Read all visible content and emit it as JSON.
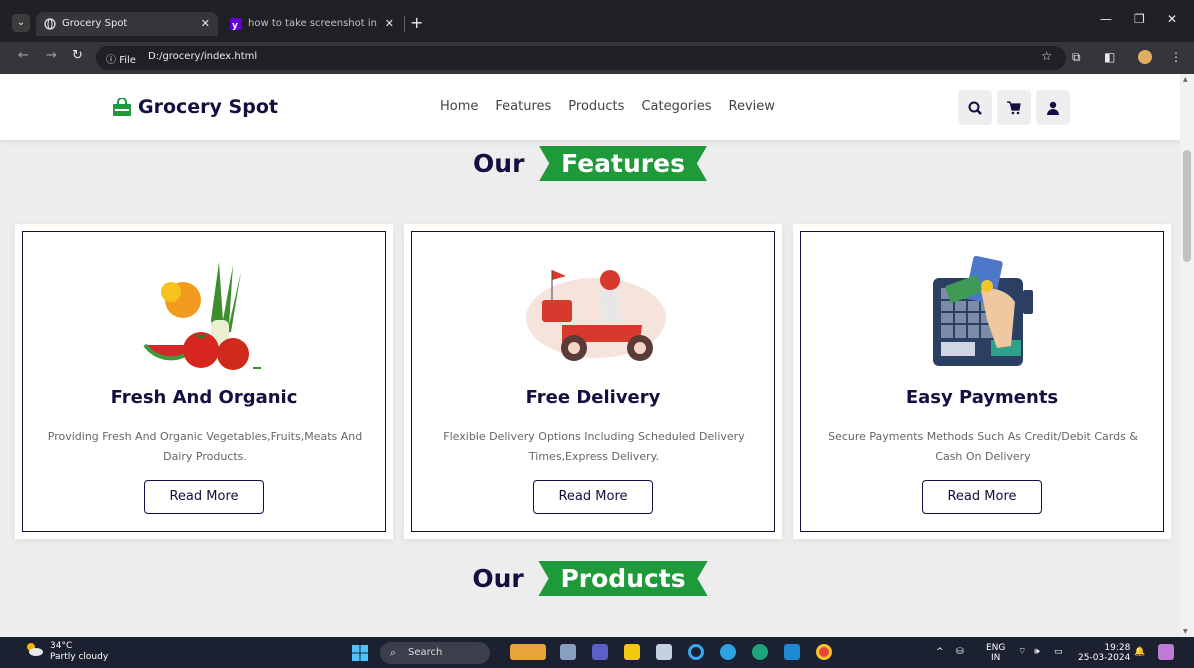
{
  "browser": {
    "tabs": [
      {
        "title": "Grocery Spot",
        "active": true
      },
      {
        "title": "how to take screenshot in lapto",
        "active": false
      }
    ],
    "omnibox": {
      "scheme_label": "File",
      "url": "D:/grocery/index.html"
    }
  },
  "site": {
    "logo": "Grocery Spot",
    "nav": [
      "Home",
      "Features",
      "Products",
      "Categories",
      "Review"
    ],
    "features_heading": {
      "prefix": "Our",
      "highlight": "Features"
    },
    "cards": [
      {
        "title": "Fresh And Organic",
        "description": "Providing Fresh And Organic Vegetables,Fruits,Meats And Dairy Products.",
        "button": "Read More",
        "image": "vegetables-illustration"
      },
      {
        "title": "Free Delivery",
        "description": "Flexible Delivery Options Including Scheduled Delivery Times,Express Delivery.",
        "button": "Read More",
        "image": "scooter-delivery-illustration"
      },
      {
        "title": "Easy Payments",
        "description": "Secure Payments Methods Such As Credit/Debit Cards & Cash On Delivery",
        "button": "Read More",
        "image": "card-payment-illustration"
      }
    ],
    "products_heading": {
      "prefix": "Our",
      "highlight": "Products"
    }
  },
  "taskbar": {
    "weather_temp": "34°C",
    "weather_desc": "Partly cloudy",
    "search_label": "Search",
    "lang_top": "ENG",
    "lang_bottom": "IN",
    "time": "19:28",
    "date": "25-03-2024"
  },
  "colors": {
    "brand_green": "#1f9a3a",
    "brand_navy": "#130f40"
  }
}
